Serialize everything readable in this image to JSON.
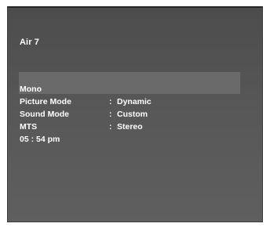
{
  "channel": "Air  7",
  "audio_mode": "Mono",
  "settings": [
    {
      "label": "Picture Mode",
      "value": "Dynamic"
    },
    {
      "label": "Sound Mode",
      "value": "Custom"
    },
    {
      "label": "MTS",
      "value": "Stereo"
    }
  ],
  "separator": ":",
  "clock": "05 : 54 pm"
}
